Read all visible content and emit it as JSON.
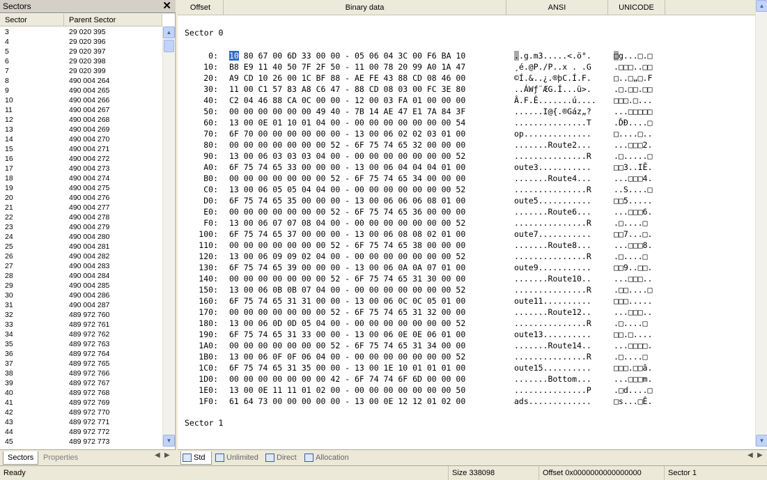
{
  "left_panel": {
    "title": "Sectors",
    "columns": [
      "Sector",
      "Parent Sector"
    ],
    "rows": [
      [
        "3",
        "29 020 395"
      ],
      [
        "4",
        "29 020 396"
      ],
      [
        "5",
        "29 020 397"
      ],
      [
        "6",
        "29 020 398"
      ],
      [
        "7",
        "29 020 399"
      ],
      [
        "8",
        "490 004 264"
      ],
      [
        "9",
        "490 004 265"
      ],
      [
        "10",
        "490 004 266"
      ],
      [
        "11",
        "490 004 267"
      ],
      [
        "12",
        "490 004 268"
      ],
      [
        "13",
        "490 004 269"
      ],
      [
        "14",
        "490 004 270"
      ],
      [
        "15",
        "490 004 271"
      ],
      [
        "16",
        "490 004 272"
      ],
      [
        "17",
        "490 004 273"
      ],
      [
        "18",
        "490 004 274"
      ],
      [
        "19",
        "490 004 275"
      ],
      [
        "20",
        "490 004 276"
      ],
      [
        "21",
        "490 004 277"
      ],
      [
        "22",
        "490 004 278"
      ],
      [
        "23",
        "490 004 279"
      ],
      [
        "24",
        "490 004 280"
      ],
      [
        "25",
        "490 004 281"
      ],
      [
        "26",
        "490 004 282"
      ],
      [
        "27",
        "490 004 283"
      ],
      [
        "28",
        "490 004 284"
      ],
      [
        "29",
        "490 004 285"
      ],
      [
        "30",
        "490 004 286"
      ],
      [
        "31",
        "490 004 287"
      ],
      [
        "32",
        "489 972 760"
      ],
      [
        "33",
        "489 972 761"
      ],
      [
        "34",
        "489 972 762"
      ],
      [
        "35",
        "489 972 763"
      ],
      [
        "36",
        "489 972 764"
      ],
      [
        "37",
        "489 972 765"
      ],
      [
        "38",
        "489 972 766"
      ],
      [
        "39",
        "489 972 767"
      ],
      [
        "40",
        "489 972 768"
      ],
      [
        "41",
        "489 972 769"
      ],
      [
        "42",
        "489 972 770"
      ],
      [
        "43",
        "489 972 771"
      ],
      [
        "44",
        "489 972 772"
      ],
      [
        "45",
        "489 972 773"
      ]
    ],
    "tabs": [
      "Sectors",
      "Properties"
    ]
  },
  "hex_view": {
    "columns": [
      "Offset",
      "Binary data",
      "ANSI",
      "UNICODE"
    ],
    "sector0_label": "Sector 0",
    "sector1_label": "Sector 1",
    "rows": [
      {
        "offset": "0:",
        "bytes": "10 80 67 00 6D 33 00 00 - 05 06 04 3C 00 F6 BA 10",
        "ansi": "..g.m3.....<.ö°.",
        "unicode": "□g...□.□"
      },
      {
        "offset": "10:",
        "bytes": "B8 E9 11 40 50 7F 2F 50 - 11 00 78 20 99 A0 1A 47",
        "ansi": "¸é.@P./P..x . .G",
        "unicode": ".□□□..□□"
      },
      {
        "offset": "20:",
        "bytes": "A9 CD 10 26 00 1C BF 88 - AE FE 43 88 CD 08 46 00",
        "ansi": "©Í.&..¿.®þC.Í.F.",
        "unicode": "□..□„□.F"
      },
      {
        "offset": "30:",
        "bytes": "11 00 C1 57 83 A8 C6 47 - 88 CD 08 03 00 FC 3E 80",
        "ansi": "..ÁWƒ¨ÆG.Í...ü>.",
        "unicode": ".□.□□.□□"
      },
      {
        "offset": "40:",
        "bytes": "C2 04 46 88 CA 0C 00 00 - 12 00 03 FA 01 00 00 00",
        "ansi": "Â.F.Ê.......ú....",
        "unicode": "□□□.□..."
      },
      {
        "offset": "50:",
        "bytes": "00 00 00 00 00 00 49 40 - 7B 14 AE 47 E1 7A 84 3F",
        "ansi": "......I@{.®Gáz„?",
        "unicode": "...□□□□□"
      },
      {
        "offset": "60:",
        "bytes": "13 00 0E 01 10 01 04 00 - 00 00 00 00 00 00 00 54",
        "ansi": "...............T",
        "unicode": ".ĎĐ....□"
      },
      {
        "offset": "70:",
        "bytes": "6F 70 00 00 00 00 00 00 - 13 00 06 02 02 03 01 00",
        "ansi": "op..............",
        "unicode": "□....□.."
      },
      {
        "offset": "80:",
        "bytes": "00 00 00 00 00 00 00 52 - 6F 75 74 65 32 00 00 00",
        "ansi": ".......Route2...",
        "unicode": "...□□□2."
      },
      {
        "offset": "90:",
        "bytes": "13 00 06 03 03 03 04 00 - 00 00 00 00 00 00 00 52",
        "ansi": "...............R",
        "unicode": ".□.....□"
      },
      {
        "offset": "A0:",
        "bytes": "6F 75 74 65 33 00 00 00 - 13 00 06 04 04 04 01 00",
        "ansi": "oute3...........",
        "unicode": "□□3..IĒ."
      },
      {
        "offset": "B0:",
        "bytes": "00 00 00 00 00 00 00 52 - 6F 75 74 65 34 00 00 00",
        "ansi": ".......Route4...",
        "unicode": "...□□□4."
      },
      {
        "offset": "C0:",
        "bytes": "13 00 06 05 05 04 04 00 - 00 00 00 00 00 00 00 52",
        "ansi": "...............R",
        "unicode": "..S....□"
      },
      {
        "offset": "D0:",
        "bytes": "6F 75 74 65 35 00 00 00 - 13 00 06 06 06 08 01 00",
        "ansi": "oute5...........",
        "unicode": "□□5....."
      },
      {
        "offset": "E0:",
        "bytes": "00 00 00 00 00 00 00 52 - 6F 75 74 65 36 00 00 00",
        "ansi": ".......Route6...",
        "unicode": "...□□□6."
      },
      {
        "offset": "F0:",
        "bytes": "13 00 06 07 07 08 04 00 - 00 00 00 00 00 00 00 52",
        "ansi": "...............R",
        "unicode": ".□....□"
      },
      {
        "offset": "100:",
        "bytes": "6F 75 74 65 37 00 00 00 - 13 00 06 08 08 02 01 00",
        "ansi": "oute7...........",
        "unicode": "□□7...□."
      },
      {
        "offset": "110:",
        "bytes": "00 00 00 00 00 00 00 52 - 6F 75 74 65 38 00 00 00",
        "ansi": ".......Route8...",
        "unicode": "...□□□8."
      },
      {
        "offset": "120:",
        "bytes": "13 00 06 09 09 02 04 00 - 00 00 00 00 00 00 00 52",
        "ansi": "...............R",
        "unicode": ".□....□"
      },
      {
        "offset": "130:",
        "bytes": "6F 75 74 65 39 00 00 00 - 13 00 06 0A 0A 07 01 00",
        "ansi": "oute9...........",
        "unicode": "□□9..□□."
      },
      {
        "offset": "140:",
        "bytes": "00 00 00 00 00 00 00 52 - 6F 75 74 65 31 30 00 00",
        "ansi": ".......Route10..",
        "unicode": "...□□□.."
      },
      {
        "offset": "150:",
        "bytes": "13 00 06 0B 0B 07 04 00 - 00 00 00 00 00 00 00 52",
        "ansi": "...............R",
        "unicode": ".□□....□"
      },
      {
        "offset": "160:",
        "bytes": "6F 75 74 65 31 31 00 00 - 13 00 06 0C 0C 05 01 00",
        "ansi": "oute11..........",
        "unicode": "□□□....."
      },
      {
        "offset": "170:",
        "bytes": "00 00 00 00 00 00 00 52 - 6F 75 74 65 31 32 00 00",
        "ansi": ".......Route12..",
        "unicode": "...□□□.."
      },
      {
        "offset": "180:",
        "bytes": "13 00 06 0D 0D 05 04 00 - 00 00 00 00 00 00 00 52",
        "ansi": "...............R",
        "unicode": ".□....□"
      },
      {
        "offset": "190:",
        "bytes": "6F 75 74 65 31 33 00 00 - 13 00 06 0E 0E 06 01 00",
        "ansi": "oute13..........",
        "unicode": "□□.□...."
      },
      {
        "offset": "1A0:",
        "bytes": "00 00 00 00 00 00 00 52 - 6F 75 74 65 31 34 00 00",
        "ansi": ".......Route14..",
        "unicode": "...□□□□."
      },
      {
        "offset": "1B0:",
        "bytes": "13 00 06 0F 0F 06 04 00 - 00 00 00 00 00 00 00 52",
        "ansi": "...............R",
        "unicode": ".□....□"
      },
      {
        "offset": "1C0:",
        "bytes": "6F 75 74 65 31 35 00 00 - 13 00 1E 10 01 01 01 00",
        "ansi": "oute15..........",
        "unicode": "□□□.□□â."
      },
      {
        "offset": "1D0:",
        "bytes": "00 00 00 00 00 00 00 42 - 6F 74 74 6F 6D 00 00 00",
        "ansi": ".......Bottom...",
        "unicode": "...□□□m."
      },
      {
        "offset": "1E0:",
        "bytes": "13 00 0E 11 11 01 02 00 - 00 00 00 00 00 00 00 50",
        "ansi": "...............P",
        "unicode": ".□d....□"
      },
      {
        "offset": "1F0:",
        "bytes": "61 64 73 00 00 00 00 00 - 13 00 0E 12 12 01 02 00",
        "ansi": "ads.............",
        "unicode": "□s...□Ê."
      }
    ],
    "tabs": [
      "Std",
      "Unlimited",
      "Direct",
      "Allocation"
    ]
  },
  "status_bar": {
    "ready": "Ready",
    "size": "Size 338098",
    "offset": "Offset 0x0000000000000000",
    "sector": "Sector 1"
  },
  "colors": {
    "selection": "#316ac5",
    "chrome": "#ece9d8",
    "scrollbar": "#c1d3fb"
  }
}
